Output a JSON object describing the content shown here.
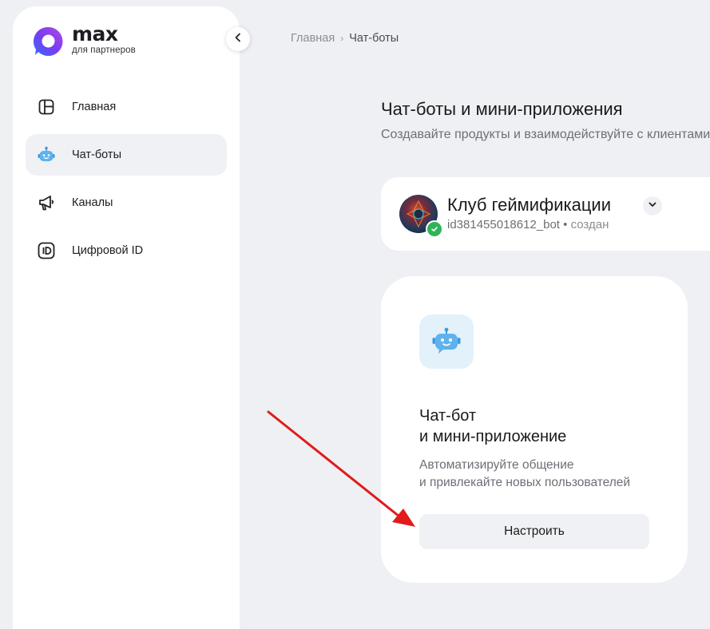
{
  "app": {
    "logo_name": "max",
    "logo_subtitle": "для партнеров"
  },
  "sidebar": {
    "items": [
      {
        "label": "Главная",
        "icon": "dashboard-icon",
        "active": false
      },
      {
        "label": "Чат-боты",
        "icon": "bot-icon",
        "active": true
      },
      {
        "label": "Каналы",
        "icon": "megaphone-icon",
        "active": false
      },
      {
        "label": "Цифровой ID",
        "icon": "id-icon",
        "active": false
      }
    ]
  },
  "breadcrumb": {
    "home": "Главная",
    "current": "Чат-боты"
  },
  "page": {
    "title": "Чат-боты и мини-приложения",
    "subtitle": "Создавайте продукты и взаимодействуйте с клиентами"
  },
  "bot": {
    "name": "Клуб геймификации",
    "id": "id381455018612_bot",
    "separator": "•",
    "status": "создан"
  },
  "feature": {
    "title_line1": "Чат-бот",
    "title_line2": "и мини-приложение",
    "desc_line1": "Автоматизируйте общение",
    "desc_line2": "и привлекайте новых пользователей",
    "button_label": "Настроить"
  },
  "colors": {
    "accent_blue": "#3d9be0",
    "verified_green": "#2fb35a",
    "annotation_arrow": "#e11b1b"
  }
}
